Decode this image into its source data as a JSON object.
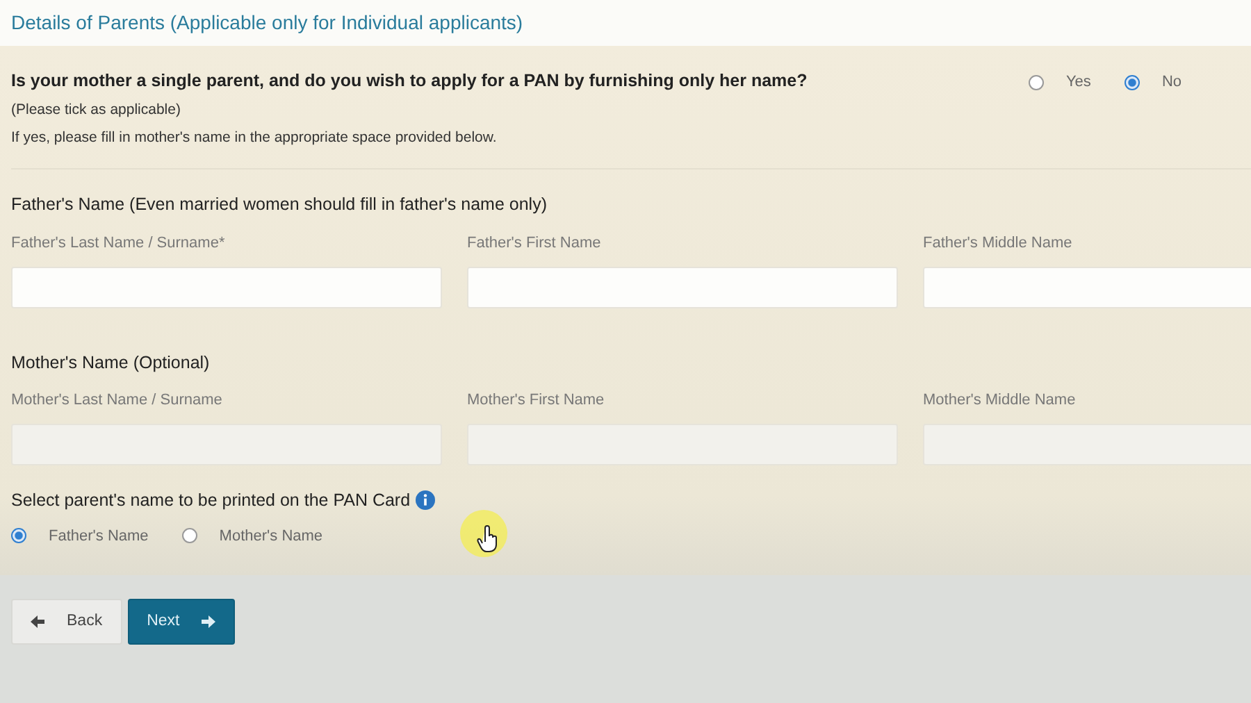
{
  "section_title": "Details of Parents (Applicable only for Individual applicants)",
  "single_parent": {
    "question": "Is your mother a single parent, and do you wish to apply for a PAN by furnishing only her name?",
    "note": "(Please tick as applicable)",
    "hint": "If yes, please fill in mother's name in the appropriate space provided below.",
    "options": [
      {
        "label": "Yes",
        "selected": false
      },
      {
        "label": "No",
        "selected": true
      }
    ]
  },
  "name_groups": [
    {
      "heading": "Father's Name (Even married women should fill in father's name only)",
      "disabled": false,
      "fields": [
        {
          "label": "Father's Last Name / Surname*"
        },
        {
          "label": "Father's First Name"
        },
        {
          "label": "Father's Middle Name"
        }
      ]
    },
    {
      "heading": "Mother's Name (Optional)",
      "disabled": true,
      "fields": [
        {
          "label": "Mother's Last Name / Surname"
        },
        {
          "label": "Mother's First Name"
        },
        {
          "label": "Mother's Middle Name"
        }
      ]
    }
  ],
  "print_choice": {
    "label": "Select parent's name to be printed on the PAN Card",
    "options": [
      {
        "label": "Father's Name",
        "selected": true
      },
      {
        "label": "Mother's Name",
        "selected": false
      }
    ]
  },
  "buttons": [
    {
      "label": "Back",
      "kind": "back"
    },
    {
      "label": "Next",
      "kind": "next"
    }
  ]
}
